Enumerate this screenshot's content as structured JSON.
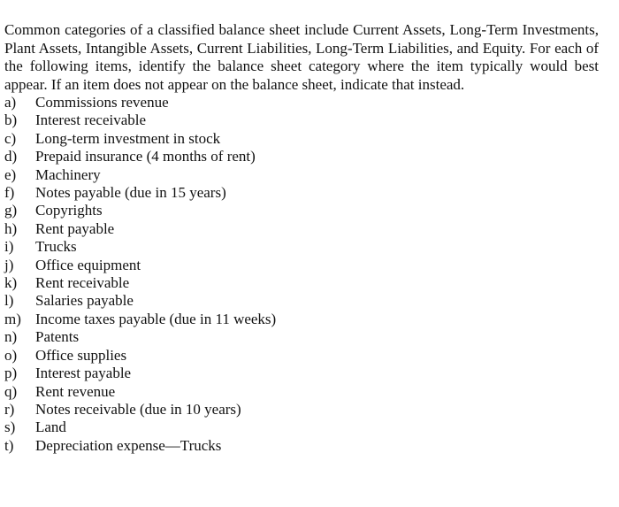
{
  "question": {
    "intro": "Common categories of a classified balance sheet include Current Assets, Long-Term Investments, Plant Assets, Intangible Assets, Current Liabilities, Long-Term Liabilities, and Equity. For each of the following items, identify the balance sheet category where the item typically would best appear. If an item does not appear on the balance sheet, indicate that instead.",
    "items": [
      {
        "letter": "a)",
        "text": "Commissions revenue"
      },
      {
        "letter": "b)",
        "text": "Interest receivable"
      },
      {
        "letter": "c)",
        "text": "Long-term investment in stock"
      },
      {
        "letter": "d)",
        "text": "Prepaid insurance (4 months of rent)"
      },
      {
        "letter": "e)",
        "text": "Machinery"
      },
      {
        "letter": "f)",
        "text": "Notes payable (due in 15 years)"
      },
      {
        "letter": "g)",
        "text": "Copyrights"
      },
      {
        "letter": "h)",
        "text": "Rent payable"
      },
      {
        "letter": "i)",
        "text": "Trucks"
      },
      {
        "letter": "j)",
        "text": "Office equipment"
      },
      {
        "letter": "k)",
        "text": "Rent receivable"
      },
      {
        "letter": "l)",
        "text": "Salaries payable"
      },
      {
        "letter": "m)",
        "text": "Income taxes payable (due in 11 weeks)"
      },
      {
        "letter": "n)",
        "text": "Patents"
      },
      {
        "letter": "o)",
        "text": "Office supplies"
      },
      {
        "letter": "p)",
        "text": "Interest payable"
      },
      {
        "letter": "q)",
        "text": "Rent revenue"
      },
      {
        "letter": "r)",
        "text": "Notes receivable (due in 10 years)"
      },
      {
        "letter": "s)",
        "text": "Land"
      },
      {
        "letter": "t)",
        "text": "Depreciation expense—Trucks"
      }
    ]
  }
}
